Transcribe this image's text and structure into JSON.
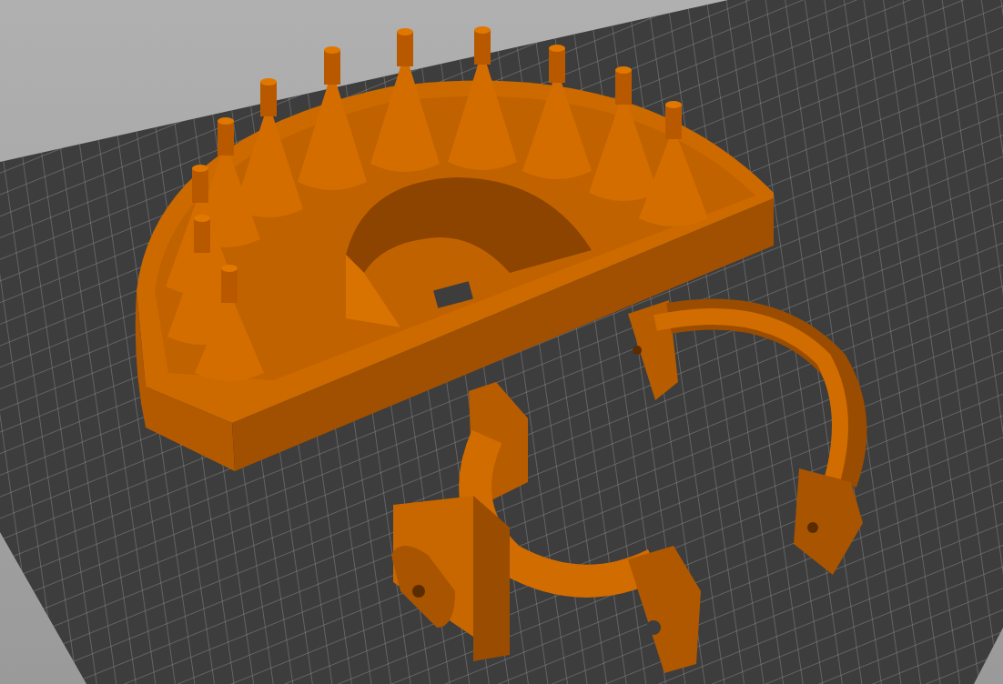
{
  "scene": {
    "objects": [
      {
        "kind": "tray"
      },
      {
        "kind": "clamp"
      },
      {
        "kind": "bracket"
      }
    ]
  }
}
